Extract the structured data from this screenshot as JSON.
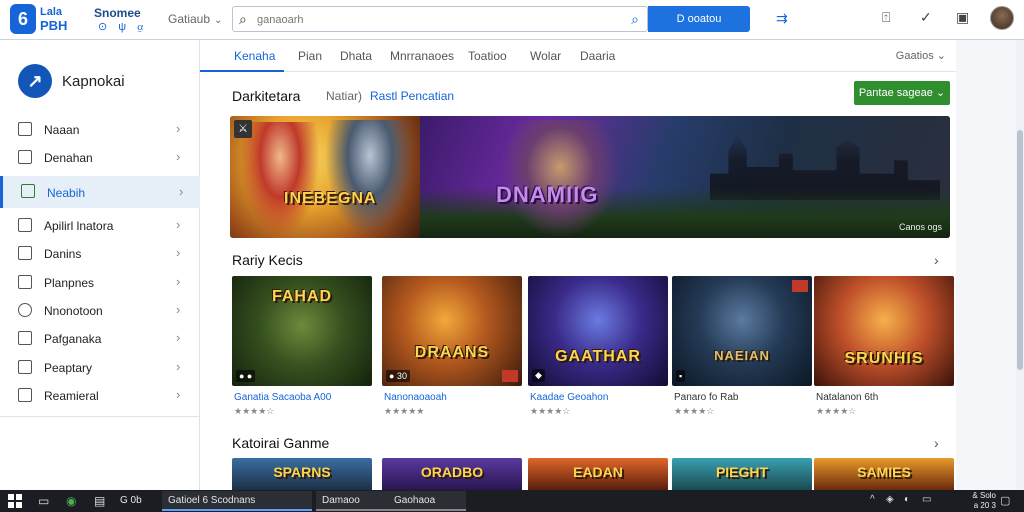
{
  "topbar": {
    "logo_letter": "6",
    "logo_top": "Lala",
    "logo_bottom": "PBH",
    "brand_top": "Snomee",
    "brand_icons": "⊙ ψ ⍶",
    "menu_label": "Gatiaub",
    "search_placeholder": "ganaoarh",
    "search_cta": "D ooatou",
    "accent_icon": "⇉"
  },
  "sidebar": {
    "logo_letter": "↗",
    "brand": "Kapnokai",
    "items": [
      {
        "label": "Naaan"
      },
      {
        "label": "Denahan"
      },
      {
        "label": "Neabih"
      },
      {
        "label": "Apilirl lnatora"
      },
      {
        "label": "Danins"
      },
      {
        "label": "Planpnes"
      },
      {
        "label": "Nnonotoon"
      },
      {
        "label": "Pafganaka"
      },
      {
        "label": "Peaptary"
      },
      {
        "label": "Reamieral"
      }
    ]
  },
  "tabs": {
    "items": [
      "Kenaha",
      "Pian",
      "Dhata",
      "Mnrranaoes",
      "Toatioo",
      "Wolar",
      "Daaria"
    ],
    "right_label": "Gaatios"
  },
  "featured": {
    "title": "Darkitetara",
    "subtitle": "Natiar)",
    "link": "Rastl Pencatian",
    "button": "Pantae sageae",
    "banner_badge": "⚔",
    "banner_text_left": "INEBEGNA",
    "banner_text_right": "DNAMIIG",
    "banner_credit": "Canos ogs"
  },
  "row1": {
    "title": "Rariy Kecis",
    "cards": [
      {
        "title": "FAHAD",
        "label": "Ganatia Sacaoba A00",
        "stars": "★★★★☆",
        "badge": "● ●",
        "theme": "green"
      },
      {
        "title": "DRAANS",
        "label": "Nanonaoaoah",
        "stars": "★★★★★",
        "badge": "● 30",
        "theme": "orange"
      },
      {
        "title": "GAATHAR",
        "label": "Kaadae Geoahon",
        "stars": "★★★★☆",
        "badge": "◆",
        "theme": "purple"
      },
      {
        "title": "NAEIAN",
        "label": "Panaro fo Rab",
        "stars": "★★★★☆",
        "badge": "▪",
        "theme": "steel"
      },
      {
        "title": "SRUNHIS",
        "label": "Natalanon 6th",
        "stars": "★★★★☆",
        "badge": "",
        "theme": "fire"
      }
    ]
  },
  "row2": {
    "title": "Katoirai Ganme",
    "cards": [
      {
        "title": "SPARNS"
      },
      {
        "title": "ORADBO"
      },
      {
        "title": "EADAN"
      },
      {
        "title": "PIEGHT"
      },
      {
        "title": "SAMIES"
      }
    ]
  },
  "taskbar": {
    "search_label": "G 0b",
    "task1": "Gatioel 6 Scodnans",
    "task2": "Damaoo",
    "task2b": "Gaohaoa",
    "clock_time": "& Solo",
    "clock_date": "a 20 3"
  }
}
